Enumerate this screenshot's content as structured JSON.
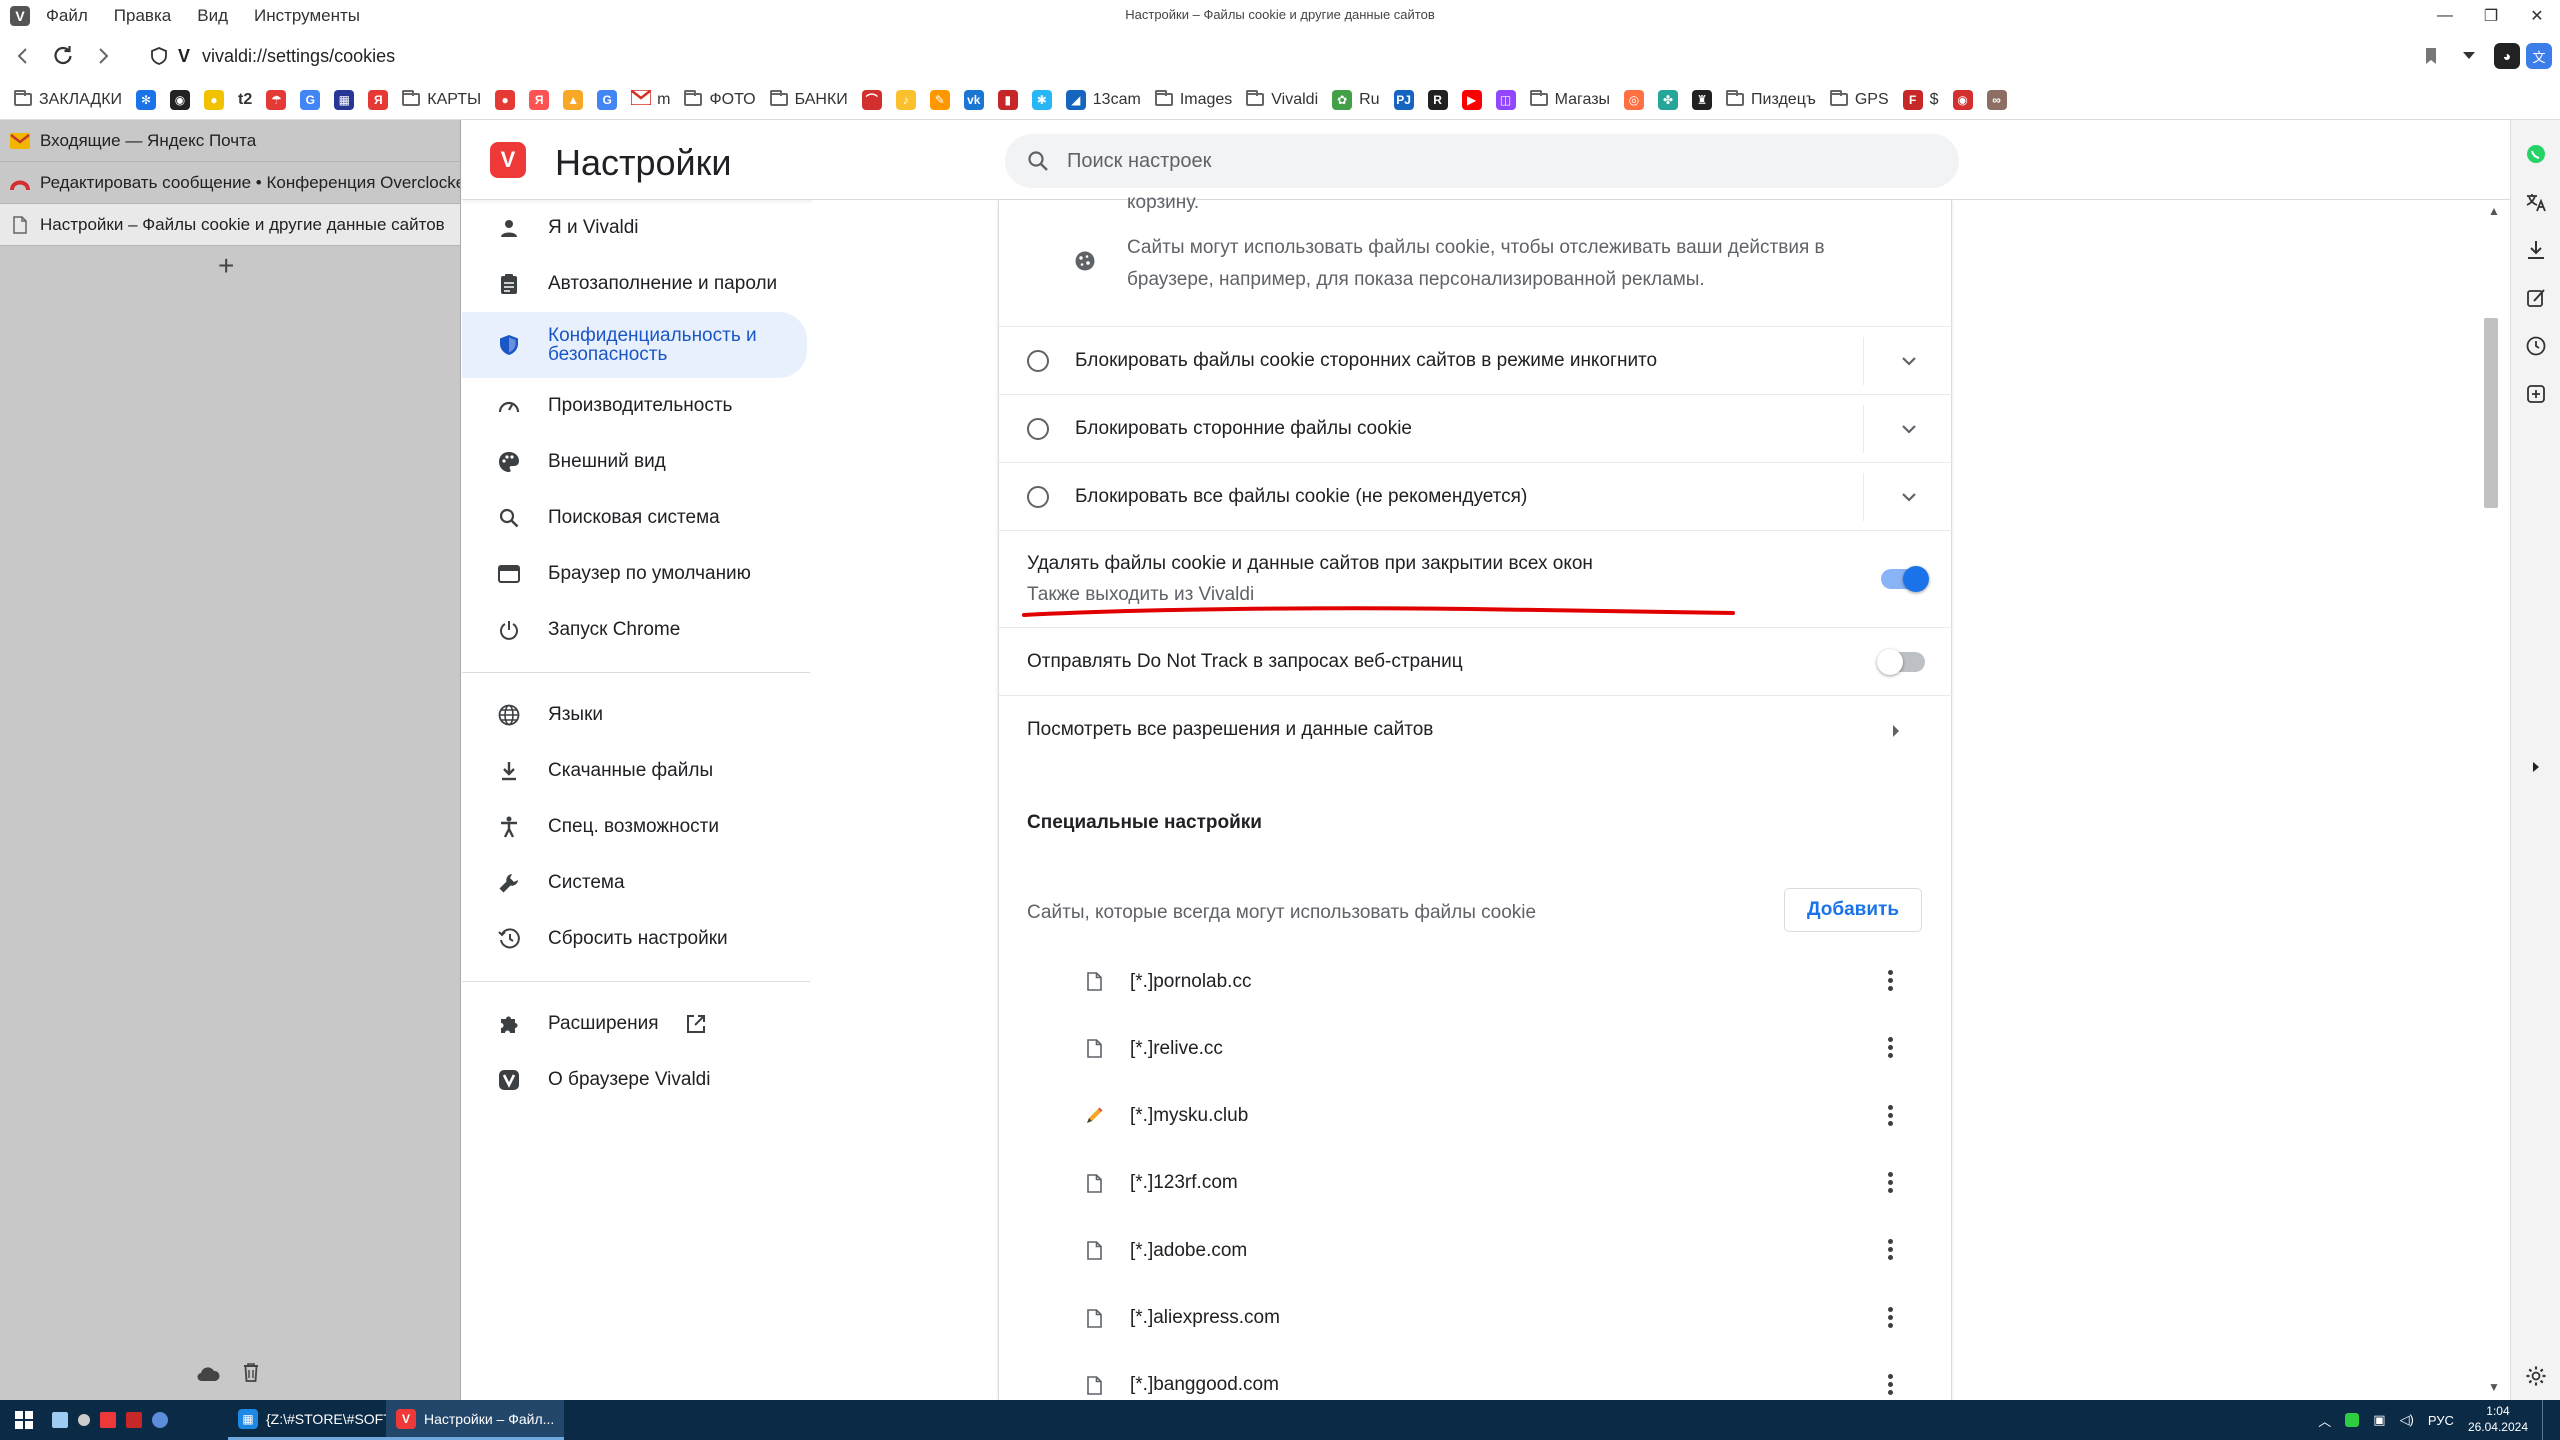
{
  "window": {
    "title": "Настройки – Файлы cookie и другие данные сайтов",
    "menu": [
      "Файл",
      "Правка",
      "Вид",
      "Инструменты"
    ]
  },
  "address": {
    "url": "vivaldi://settings/cookies"
  },
  "bookmarks": [
    {
      "label": "ЗАКЛАДКИ",
      "kind": "folder"
    },
    {
      "label": "",
      "kind": "fav",
      "color": "#1a73e8",
      "glyph": "✻"
    },
    {
      "label": "",
      "kind": "fav",
      "color": "#222222",
      "glyph": "◉"
    },
    {
      "label": "",
      "kind": "fav",
      "color": "#f2c200",
      "glyph": "●"
    },
    {
      "label": "t2",
      "kind": "text"
    },
    {
      "label": "",
      "kind": "fav",
      "color": "#e53935",
      "glyph": "☂"
    },
    {
      "label": "",
      "kind": "fav",
      "color": "#4285f4",
      "glyph": "G"
    },
    {
      "label": "",
      "kind": "fav",
      "color": "#283593",
      "glyph": "▦"
    },
    {
      "label": "",
      "kind": "fav",
      "color": "#e53935",
      "glyph": "Я"
    },
    {
      "label": "КАРТЫ",
      "kind": "folder"
    },
    {
      "label": "",
      "kind": "fav",
      "color": "#e53935",
      "glyph": "●"
    },
    {
      "label": "",
      "kind": "fav",
      "color": "#ff5252",
      "glyph": "Я"
    },
    {
      "label": "",
      "kind": "fav",
      "color": "#f9a825",
      "glyph": "▲"
    },
    {
      "label": "",
      "kind": "fav",
      "color": "#4285f4",
      "glyph": "G"
    },
    {
      "label": "m",
      "kind": "mail"
    },
    {
      "label": "ФОТО",
      "kind": "folder"
    },
    {
      "label": "БАНКИ",
      "kind": "folder"
    },
    {
      "label": "",
      "kind": "fav",
      "color": "#d32f2f",
      "glyph": "⌒"
    },
    {
      "label": "",
      "kind": "fav",
      "color": "#fbc02d",
      "glyph": "♪"
    },
    {
      "label": "",
      "kind": "fav",
      "color": "#ff9800",
      "glyph": "✎"
    },
    {
      "label": "",
      "kind": "fav",
      "color": "#1976d2",
      "glyph": "vk"
    },
    {
      "label": "",
      "kind": "fav",
      "color": "#c62828",
      "glyph": "▮"
    },
    {
      "label": "",
      "kind": "fav",
      "color": "#29b6f6",
      "glyph": "✱"
    },
    {
      "label": "13cam",
      "kind": "fav-text",
      "color": "#1565c0",
      "glyph": "◢"
    },
    {
      "label": "Images",
      "kind": "folder"
    },
    {
      "label": "Vivaldi",
      "kind": "folder"
    },
    {
      "label": "Ru",
      "kind": "fav-text",
      "color": "#43a047",
      "glyph": "✿"
    },
    {
      "label": "",
      "kind": "fav",
      "color": "#1565c0",
      "glyph": "PJ"
    },
    {
      "label": "",
      "kind": "fav",
      "color": "#212121",
      "glyph": "R"
    },
    {
      "label": "",
      "kind": "fav",
      "color": "#ff0000",
      "glyph": "▶"
    },
    {
      "label": "",
      "kind": "fav",
      "color": "#9146ff",
      "glyph": "◫"
    },
    {
      "label": "Магазы",
      "kind": "folder"
    },
    {
      "label": "",
      "kind": "fav",
      "color": "#ff7043",
      "glyph": "◎"
    },
    {
      "label": "",
      "kind": "fav",
      "color": "#26a69a",
      "glyph": "✤"
    },
    {
      "label": "",
      "kind": "fav",
      "color": "#212121",
      "glyph": "♜"
    },
    {
      "label": "Пиздецъ",
      "kind": "folder"
    },
    {
      "label": "GPS",
      "kind": "folder"
    },
    {
      "label": "$",
      "kind": "fav-text",
      "color": "#c62828",
      "glyph": "F"
    },
    {
      "label": "",
      "kind": "fav",
      "color": "#d32f2f",
      "glyph": "◉"
    },
    {
      "label": "",
      "kind": "fav",
      "color": "#8d6e63",
      "glyph": "∞"
    }
  ],
  "tabs": [
    {
      "title": "Входящие — Яндекс Почта",
      "color": "#f2b600",
      "glyph": "✉"
    },
    {
      "title": "Редактировать сообщение • Конференция Overclockers",
      "color": "#d32f2f",
      "glyph": "⌒"
    },
    {
      "title": "Настройки – Файлы cookie и другие данные сайтов",
      "color": "#777777",
      "glyph": "▯"
    }
  ],
  "settings": {
    "title": "Настройки",
    "search_placeholder": "Поиск настроек",
    "nav": [
      {
        "label": "Я и Vivaldi",
        "icon": "person-icon"
      },
      {
        "label": "Автозаполнение и пароли",
        "icon": "clipboard-icon"
      },
      {
        "label": "Конфиденциальность и безопасность",
        "icon": "shield-icon",
        "active": true
      },
      {
        "label": "Производительность",
        "icon": "speedometer-icon"
      },
      {
        "label": "Внешний вид",
        "icon": "palette-icon"
      },
      {
        "label": "Поисковая система",
        "icon": "search-icon"
      },
      {
        "label": "Браузер по умолчанию",
        "icon": "browser-icon"
      },
      {
        "label": "Запуск Chrome",
        "icon": "power-icon"
      }
    ],
    "nav2": [
      {
        "label": "Языки",
        "icon": "globe-icon"
      },
      {
        "label": "Скачанные файлы",
        "icon": "download-icon"
      },
      {
        "label": "Спец. возможности",
        "icon": "accessibility-icon"
      },
      {
        "label": "Система",
        "icon": "wrench-icon"
      },
      {
        "label": "Сбросить настройки",
        "icon": "history-icon"
      }
    ],
    "nav3": [
      {
        "label": "Расширения",
        "icon": "puzzle-icon"
      },
      {
        "label": "О браузере Vivaldi",
        "icon": "vivaldi-icon"
      }
    ]
  },
  "cookies": {
    "partial_text": "корзину.",
    "tracking_info": "Сайты могут использовать файлы cookie, чтобы отслеживать ваши действия в браузере, например, для показа персонализированной рекламы.",
    "options": [
      "Блокировать файлы cookie сторонних сайтов в режиме инкогнито",
      "Блокировать сторонние файлы cookie",
      "Блокировать все файлы cookie (не рекомендуется)"
    ],
    "clear_on_exit": {
      "label": "Удалять файлы cookie и данные сайтов при закрытии всех окон",
      "sublabel": "Также выходить из Vivaldi",
      "enabled": true
    },
    "do_not_track": {
      "label": "Отправлять Do Not Track в запросах веб-страниц",
      "enabled": false
    },
    "all_permissions": "Посмотреть все разрешения и данные сайтов",
    "special_heading": "Специальные настройки",
    "allowed_heading": "Сайты, которые всегда могут использовать файлы cookie",
    "add_button": "Добавить",
    "sites": [
      {
        "domain": "[*.]pornolab.cc",
        "icon": "file-icon"
      },
      {
        "domain": "[*.]relive.cc",
        "icon": "file-icon"
      },
      {
        "domain": "[*.]mysku.club",
        "icon": "pencil-icon"
      },
      {
        "domain": "[*.]123rf.com",
        "icon": "file-icon"
      },
      {
        "domain": "[*.]adobe.com",
        "icon": "file-icon"
      },
      {
        "domain": "[*.]aliexpress.com",
        "icon": "file-icon"
      },
      {
        "domain": "[*.]banggood.com",
        "icon": "file-icon"
      }
    ]
  },
  "taskbar": {
    "tasks": [
      {
        "label": "{Z:\\#STORE\\#SOFT\\...",
        "color": "#1e88e5",
        "glyph": "▦"
      },
      {
        "label": "Настройки – Файл...",
        "color": "#ef3939",
        "glyph": "V"
      }
    ],
    "lang": "РУС",
    "time": "1:04",
    "date": "26.04.2024"
  },
  "colors": {
    "accent": "#1a73e8",
    "annotation_red": "#e00000"
  }
}
